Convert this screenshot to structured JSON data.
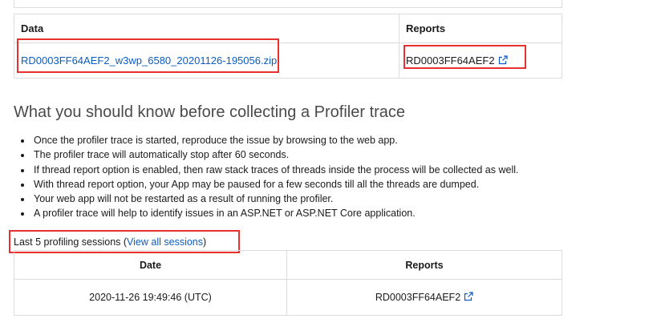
{
  "download_table": {
    "headers": {
      "data": "Data",
      "reports": "Reports"
    },
    "row": {
      "data_file": "RD0003FF64AEF2_w3wp_6580_20201126-195056.zip",
      "report": "RD0003FF64AEF2"
    }
  },
  "info": {
    "heading": "What you should know before collecting a Profiler trace",
    "bullets": [
      "Once the profiler trace is started, reproduce the issue by browsing to the web app.",
      "The profiler trace will automatically stop after 60 seconds.",
      "If thread report option is enabled, then raw stack traces of threads inside the process will be collected as well.",
      "With thread report option, your App may be paused for a few seconds till all the threads are dumped.",
      "Your web app will not be restarted as a result of running the profiler.",
      "A profiler trace will help to identify issues in an ASP.NET or ASP.NET Core application."
    ]
  },
  "sessions": {
    "label_prefix": "Last 5 profiling sessions (",
    "view_all_link": "View all sessions",
    "label_suffix": ")",
    "headers": {
      "date": "Date",
      "reports": "Reports"
    },
    "rows": [
      {
        "date": "2020-11-26 19:49:46 (UTC)",
        "report": "RD0003FF64AEF2"
      }
    ]
  },
  "colors": {
    "link": "#0a5cc2",
    "highlight_box": "#e8312f",
    "border": "#dcdcdc"
  },
  "icons": {
    "external_link": "external-link-icon"
  }
}
